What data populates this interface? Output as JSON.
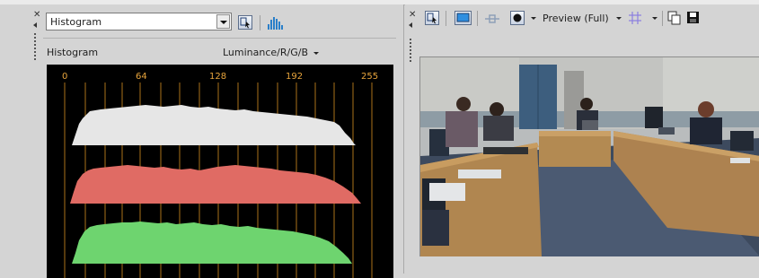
{
  "histogram_panel": {
    "view_dropdown_value": "Histogram",
    "title": "Histogram",
    "channel_mode": "Luminance/R/G/B",
    "axis_ticks": [
      "0",
      "64",
      "128",
      "192",
      "255"
    ],
    "channel_fill_colors": {
      "luminance": "#e6e6e6",
      "red": "#e06b64",
      "green": "#6ed46f"
    },
    "axis_color": "#e7a43c"
  },
  "preview_panel": {
    "quality_label": "Preview (Full)"
  },
  "colors": {
    "panel_bg": "#d4d4d4",
    "histogram_bg": "#000000"
  }
}
